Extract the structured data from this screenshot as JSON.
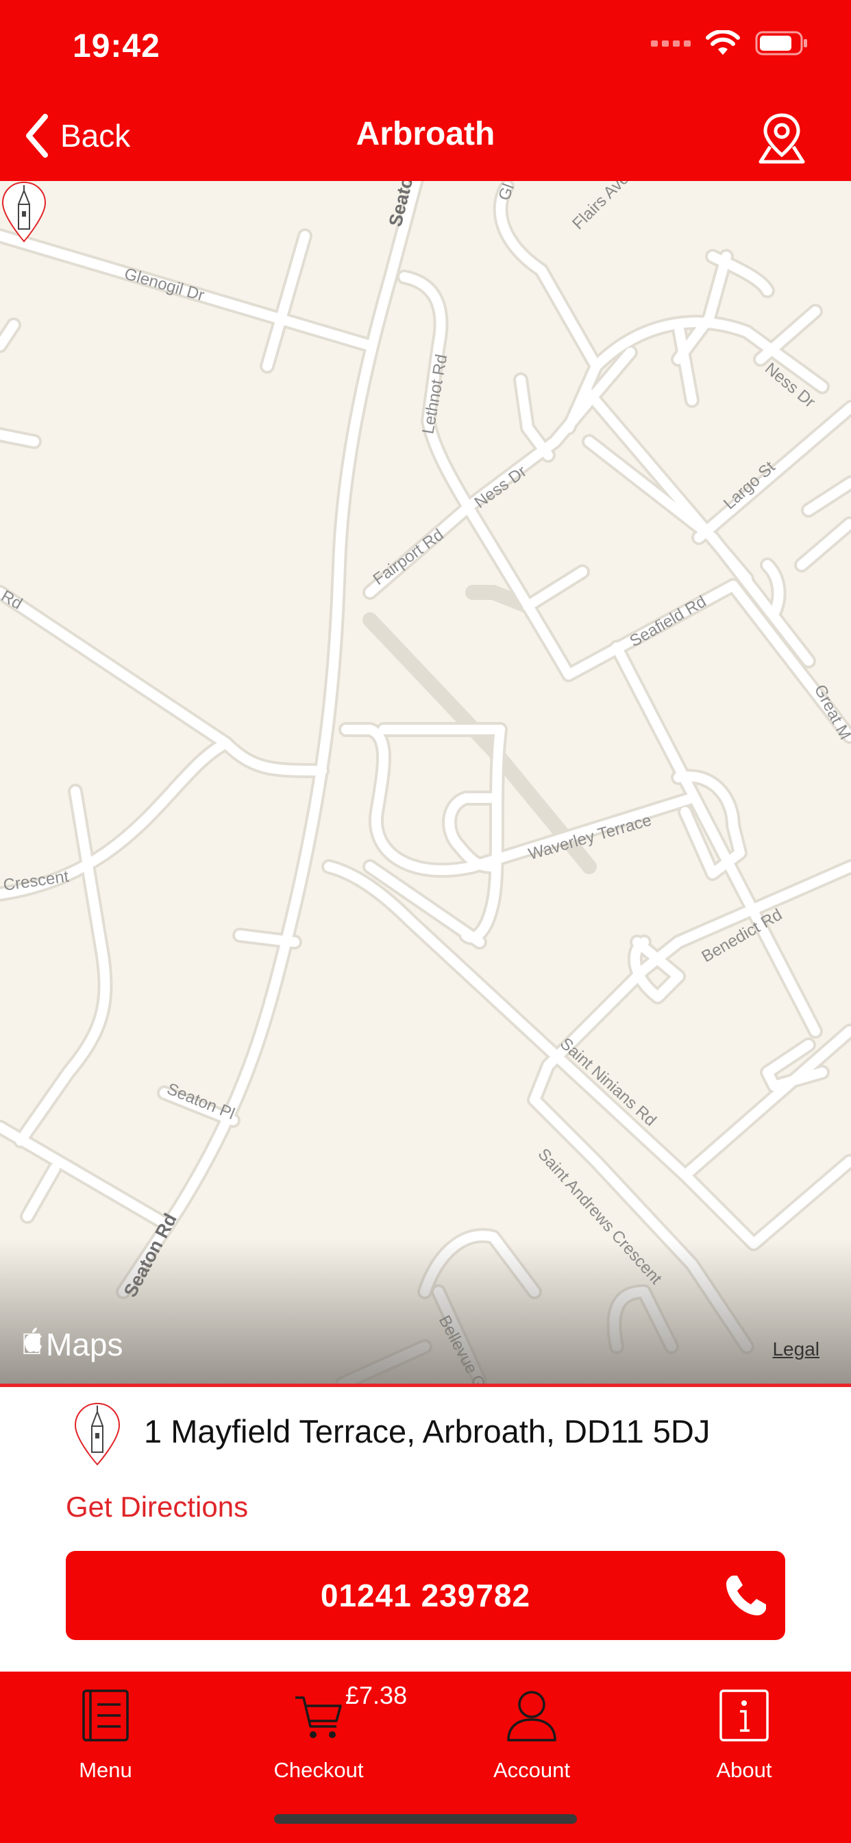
{
  "status_bar": {
    "time": "19:42",
    "icons": [
      "signal-icon",
      "wifi-icon",
      "battery-icon"
    ]
  },
  "nav": {
    "back_label": "Back",
    "title": "Arbroath",
    "location_icon": "location-pin-icon"
  },
  "map": {
    "provider_label": "Maps",
    "legal_label": "Legal",
    "street_labels": [
      "Glenogil Dr",
      "Seaton Rd",
      "Flairs Ave",
      "Lethnot Rd",
      "Ness Dr",
      "Fairport Rd",
      "Ness Dr",
      "Largo St",
      "Seafield Rd",
      "Great M",
      "Rd",
      "Crescent",
      "Waverley Terrace",
      "Benedict Rd",
      "Saint Ninians Rd",
      "Seaton Pl",
      "Saint Andrews Crescent",
      "Seaton Rd",
      "Bellevue G",
      "Gl",
      "Seato"
    ]
  },
  "store": {
    "address": "1 Mayfield Terrace, Arbroath, DD11 5DJ",
    "directions_label": "Get Directions",
    "phone": "01241 239782"
  },
  "tabs": [
    {
      "label": "Menu",
      "icon": "menu-book-icon"
    },
    {
      "label": "Checkout",
      "icon": "cart-icon"
    },
    {
      "label": "Account",
      "icon": "person-icon"
    },
    {
      "label": "About",
      "icon": "info-icon"
    }
  ],
  "cart": {
    "total": "£7.38"
  },
  "colors": {
    "brand_red": "#f20505",
    "link_red": "#e02428",
    "map_bg": "#f7f3ea",
    "road": "#ffffff"
  }
}
